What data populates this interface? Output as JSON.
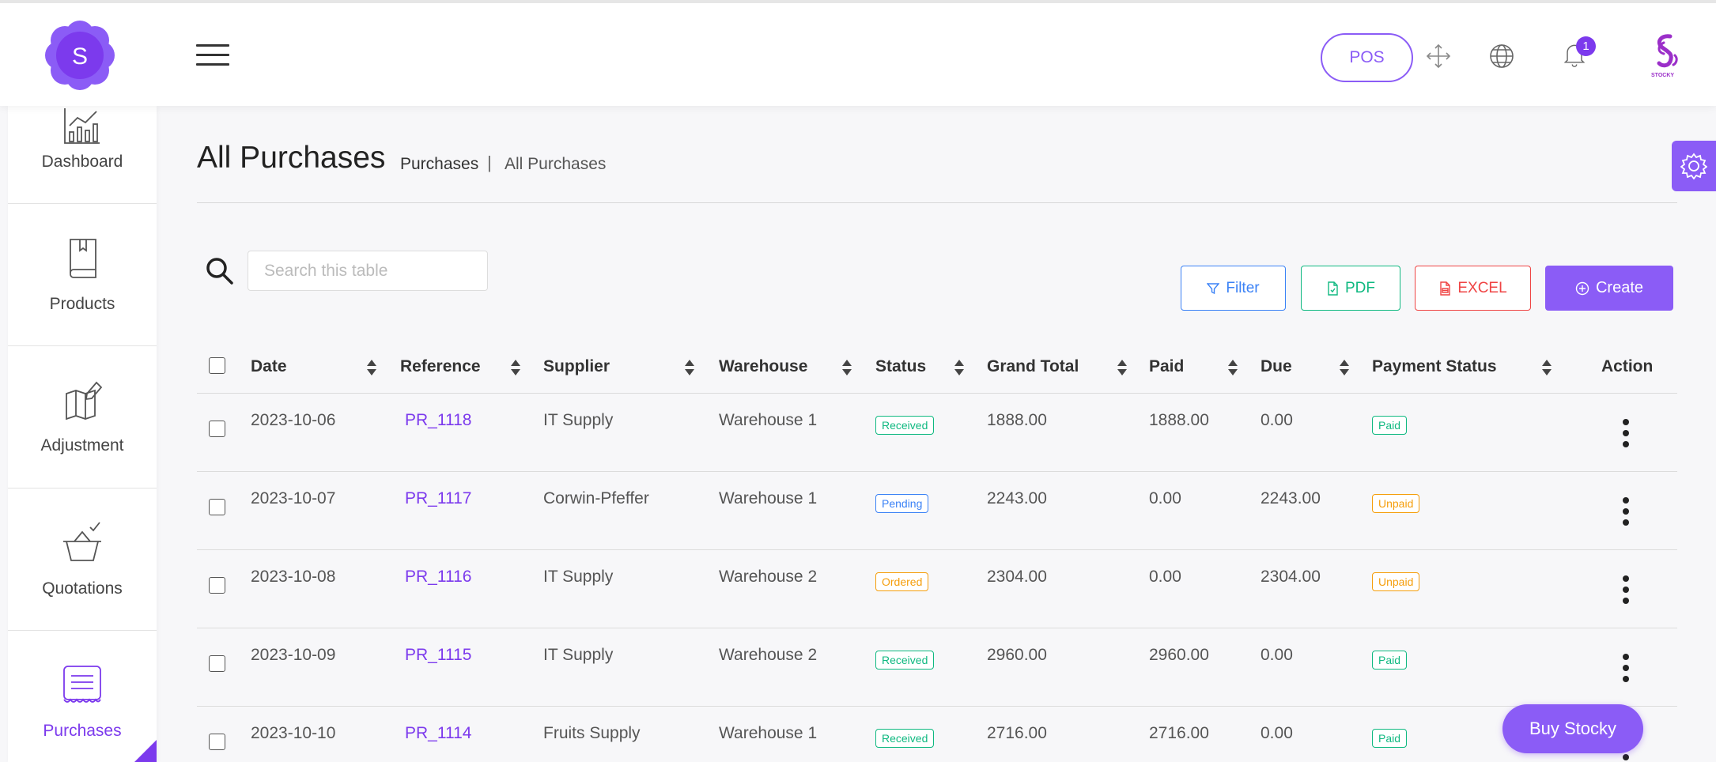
{
  "header": {
    "logo_letter": "S",
    "pos_label": "POS",
    "notification_count": "1",
    "brand_text": "STOCKY"
  },
  "sidebar": {
    "items": [
      {
        "label": "Dashboard",
        "icon": "chart-icon"
      },
      {
        "label": "Products",
        "icon": "book-icon"
      },
      {
        "label": "Adjustment",
        "icon": "map-edit-icon"
      },
      {
        "label": "Quotations",
        "icon": "basket-check-icon"
      },
      {
        "label": "Purchases",
        "icon": "receipt-icon",
        "active": true
      }
    ]
  },
  "page": {
    "title": "All Purchases",
    "breadcrumb": [
      "Purchases",
      "|",
      "All Purchases"
    ]
  },
  "search": {
    "placeholder": "Search this table",
    "value": ""
  },
  "toolbar": {
    "filter_label": "Filter",
    "pdf_label": "PDF",
    "excel_label": "EXCEL",
    "create_label": "Create"
  },
  "table": {
    "columns": [
      "Date",
      "Reference",
      "Supplier",
      "Warehouse",
      "Status",
      "Grand Total",
      "Paid",
      "Due",
      "Payment Status",
      "Action"
    ],
    "rows": [
      {
        "date": "2023-10-06",
        "reference": "PR_1118",
        "supplier": "IT Supply",
        "warehouse": "Warehouse 1",
        "status": "Received",
        "grand_total": "1888.00",
        "paid": "1888.00",
        "due": "0.00",
        "payment_status": "Paid"
      },
      {
        "date": "2023-10-07",
        "reference": "PR_1117",
        "supplier": "Corwin-Pfeffer",
        "warehouse": "Warehouse 1",
        "status": "Pending",
        "grand_total": "2243.00",
        "paid": "0.00",
        "due": "2243.00",
        "payment_status": "Unpaid"
      },
      {
        "date": "2023-10-08",
        "reference": "PR_1116",
        "supplier": "IT Supply",
        "warehouse": "Warehouse 2",
        "status": "Ordered",
        "grand_total": "2304.00",
        "paid": "0.00",
        "due": "2304.00",
        "payment_status": "Unpaid"
      },
      {
        "date": "2023-10-09",
        "reference": "PR_1115",
        "supplier": "IT Supply",
        "warehouse": "Warehouse 2",
        "status": "Received",
        "grand_total": "2960.00",
        "paid": "2960.00",
        "due": "0.00",
        "payment_status": "Paid"
      },
      {
        "date": "2023-10-10",
        "reference": "PR_1114",
        "supplier": "Fruits Supply",
        "warehouse": "Warehouse 1",
        "status": "Received",
        "grand_total": "2716.00",
        "paid": "2716.00",
        "due": "0.00",
        "payment_status": "Paid"
      }
    ]
  },
  "buy_button": "Buy Stocky",
  "colors": {
    "accent": "#8b5cf6",
    "received": "#10b981",
    "pending": "#3b82f6",
    "ordered": "#f59e0b",
    "unpaid": "#f59e0b",
    "excel": "#ef4444"
  }
}
